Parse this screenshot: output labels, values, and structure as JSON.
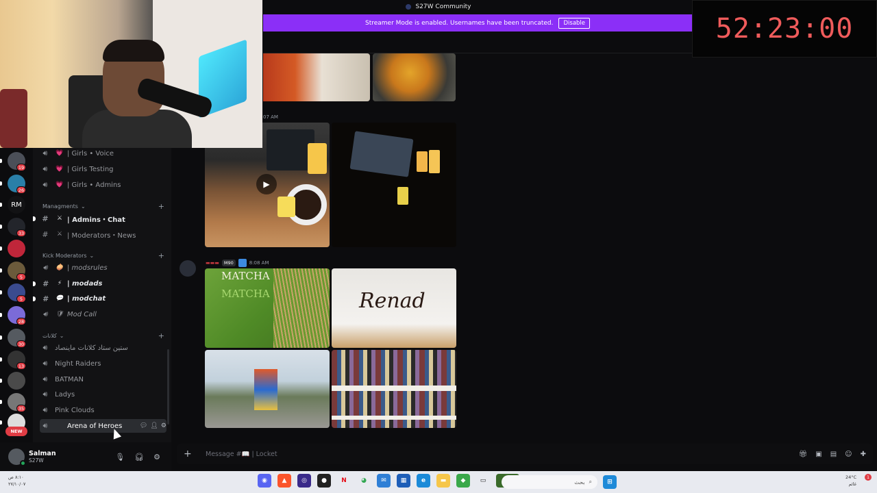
{
  "window": {
    "title": "S27W Community"
  },
  "banner": {
    "text": "Streamer Mode is enabled. Usernames have been truncated.",
    "button": "Disable"
  },
  "timer": {
    "value": "52:23:00"
  },
  "rail": {
    "servers": [
      {
        "label": "",
        "badge": "19",
        "color": "#4b4f58"
      },
      {
        "label": "",
        "badge": "26",
        "color": "#2a7fa8"
      },
      {
        "label": "RM",
        "badge": "",
        "color": "#121214"
      },
      {
        "label": "",
        "badge": "33",
        "color": "#23252b"
      },
      {
        "label": "",
        "badge": "",
        "color": "#c0263a"
      },
      {
        "label": "",
        "badge": "5",
        "color": "#6b5a3b"
      },
      {
        "label": "",
        "badge": "5",
        "color": "#3a4b8f"
      },
      {
        "label": "",
        "badge": "28",
        "color": "#7b6bd8"
      },
      {
        "label": "",
        "badge": "30",
        "color": "#555a60"
      },
      {
        "label": "",
        "badge": "13",
        "color": "#333"
      },
      {
        "label": "",
        "badge": "",
        "color": "#4a4a4a"
      },
      {
        "label": "",
        "badge": "35",
        "color": "#777"
      },
      {
        "label": "",
        "badge": "",
        "color": "#ddd"
      }
    ],
    "new_label": "NEW"
  },
  "channels": {
    "items": [
      {
        "type": "voice",
        "emoji": "💗",
        "name": "| Girls • Voice"
      },
      {
        "type": "voice",
        "emoji": "💗",
        "name": "| Girls Testing"
      },
      {
        "type": "voice",
        "emoji": "💗",
        "name": "| Girls • Admins"
      }
    ],
    "cat_managments": "Managments",
    "managments": [
      {
        "type": "text",
        "emoji": "⚔",
        "name": "| Admins・Chat"
      },
      {
        "type": "text",
        "emoji": "⚔",
        "name": "| Moderators・News"
      }
    ],
    "cat_kick": "Kick Moderators",
    "kick": [
      {
        "type": "voice",
        "emoji": "🧅",
        "name": "| modsrules"
      },
      {
        "type": "text",
        "emoji": "⚡",
        "name": "| modads"
      },
      {
        "type": "text",
        "emoji": "💬",
        "name": "| modchat"
      },
      {
        "type": "voice",
        "emoji": "🛡",
        "name": "Mod Call"
      }
    ],
    "cat_other": "كلانات",
    "other": [
      {
        "name": "ستين ستاد كلانات ماينصاد"
      },
      {
        "name": "Night Raiders"
      },
      {
        "name": "BATMAN"
      },
      {
        "name": "Ladys"
      },
      {
        "name": "Pink Clouds"
      },
      {
        "name": "Arena of Heroes"
      }
    ]
  },
  "user": {
    "name": "Salman",
    "tag": "S27W"
  },
  "chat": {
    "timestamp1": "07 AM",
    "msg_tag": "M90",
    "timestamp2": "8:08 AM",
    "img_text_matcha": "MATCHA",
    "img_text_matcha2": "MATCHA",
    "img_text_renad": "Renad"
  },
  "composer": {
    "placeholder": "Message #📖 | Locket"
  },
  "taskbar": {
    "left_time": "٨:١٠ ص",
    "left_date": "٢٧/١٠/٠٧",
    "search": "بحث",
    "right_temp": "24°C",
    "right_weather": "غائم",
    "notif": "1"
  },
  "colors": {
    "accent": "#8b2ff7",
    "timer": "#ef5b5b",
    "badge": "#e03c44"
  }
}
